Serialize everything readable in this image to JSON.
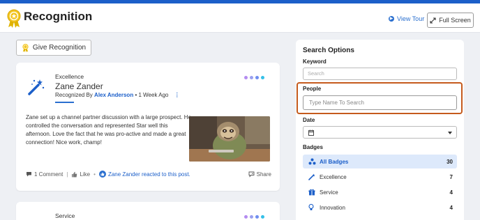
{
  "header": {
    "title": "Recognition",
    "view_tour": "View Tour",
    "full_screen": "Full Screen"
  },
  "give_button": "Give Recognition",
  "posts": [
    {
      "category": "Excellence",
      "recipient": "Zane Zander",
      "recognized_by_prefix": "Recognized By",
      "author": "Alex Anderson",
      "time": "• 1 Week Ago",
      "message": "Zane set up a channel partner discussion with a large prospect. He controlled the conversation and represented Star well this afternoon. Love the fact that he was pro-active and made a great connection! Nice work, champ!",
      "comments": "1 Comment",
      "like": "Like",
      "reaction": "Zane Zander reacted to this post.",
      "share": "Share"
    },
    {
      "category": "Service"
    }
  ],
  "search": {
    "title": "Search Options",
    "keyword_label": "Keyword",
    "keyword_placeholder": "Search",
    "people_label": "People",
    "people_placeholder": "Type Name To Search",
    "date_label": "Date",
    "badges_label": "Badges",
    "badges": [
      {
        "name": "All Badges",
        "count": "30",
        "icon": "badges-cluster-icon",
        "active": true
      },
      {
        "name": "Excellence",
        "count": "7",
        "icon": "magic-wand-icon",
        "active": false
      },
      {
        "name": "Service",
        "count": "4",
        "icon": "gift-icon",
        "active": false
      },
      {
        "name": "Innovation",
        "count": "4",
        "icon": "lightbulb-icon",
        "active": false
      }
    ]
  },
  "colors": {
    "accent": "#1c5fc9",
    "highlight_border": "#c55a1c",
    "badge_gold": "#e0b400",
    "dot_colors": [
      "#b48cf0",
      "#9aa0f0",
      "#6f8ef0",
      "#34c0e8"
    ]
  }
}
